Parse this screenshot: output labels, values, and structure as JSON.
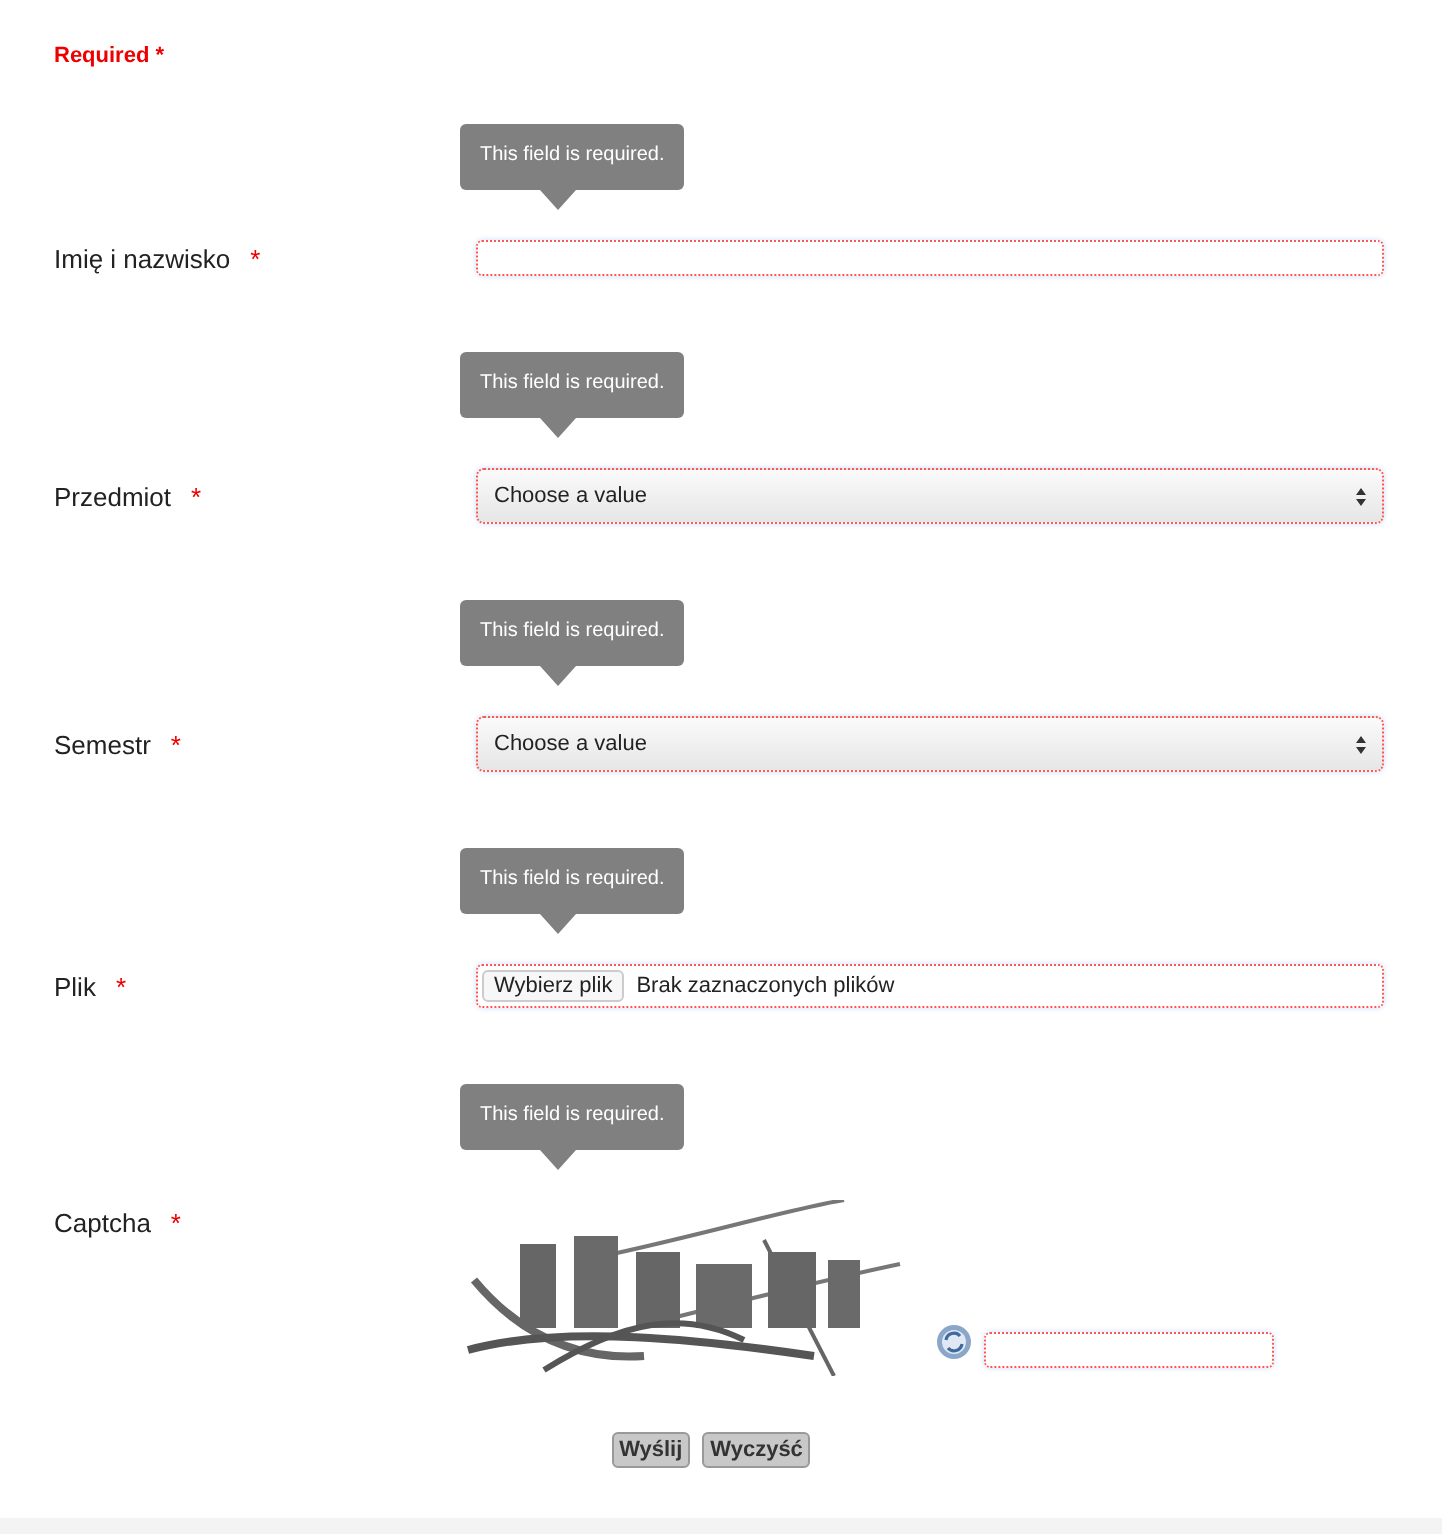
{
  "required_note": {
    "text": "Required",
    "marker": "*"
  },
  "fields": [
    {
      "kind": "text",
      "label": "Imię i nazwisko",
      "marker": "*",
      "tooltip": "This field is required.",
      "invalid": true
    },
    {
      "kind": "select",
      "label": "Przedmiot",
      "marker": "*",
      "tooltip": "This field is required.",
      "invalid": true,
      "value": "Choose a value"
    },
    {
      "kind": "select",
      "label": "Semestr",
      "marker": "*",
      "tooltip": "This field is required.",
      "invalid": true,
      "value": "Choose a value"
    },
    {
      "kind": "file",
      "label": "Plik",
      "marker": "*",
      "tooltip": "This field is required.",
      "invalid": true,
      "button": "Wybierz plik",
      "status": "Brak zaznaczonych plików"
    },
    {
      "kind": "captcha",
      "label": "Captcha",
      "marker": "*",
      "tooltip": "This field is required.",
      "invalid": true
    }
  ],
  "buttons": [
    "Wyślij",
    "Wyczyść"
  ]
}
